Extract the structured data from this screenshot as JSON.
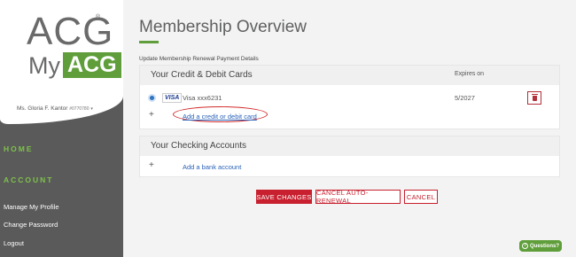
{
  "brand": {
    "logo_main": "ACG",
    "logo_my": "My",
    "logo_badge": "ACG",
    "logo_reg": "®",
    "accent_color": "#5f9e3a",
    "danger_color": "#c8202f"
  },
  "user": {
    "name": "Ms. Gloria F. Kantor",
    "id": "#0770780",
    "caret": "▾"
  },
  "sidebar": {
    "home_label": "HOME",
    "account_label": "ACCOUNT",
    "items": [
      {
        "label": "Manage My Profile"
      },
      {
        "label": "Change Password"
      },
      {
        "label": "Logout"
      }
    ]
  },
  "page": {
    "title": "Membership Overview",
    "subheading": "Update Membership Renewal Payment Details"
  },
  "cards_panel": {
    "title": "Your Credit & Debit Cards",
    "expires_header": "Expires on",
    "card": {
      "brand": "VISA",
      "label": "Visa xxx6231",
      "expiry": "5/2027",
      "selected": true,
      "icon": "trash-icon"
    },
    "add_link": "Add a credit or debit card",
    "add_symbol": "+"
  },
  "checking_panel": {
    "title": "Your Checking Accounts",
    "add_link": "Add a bank account",
    "add_symbol": "+"
  },
  "actions": {
    "save": "SAVE CHANGES",
    "cancel_renewal": "CANCEL AUTO-RENEWAL",
    "cancel": "CANCEL"
  },
  "help": {
    "icon_glyph": "?",
    "label": "Questions?"
  }
}
